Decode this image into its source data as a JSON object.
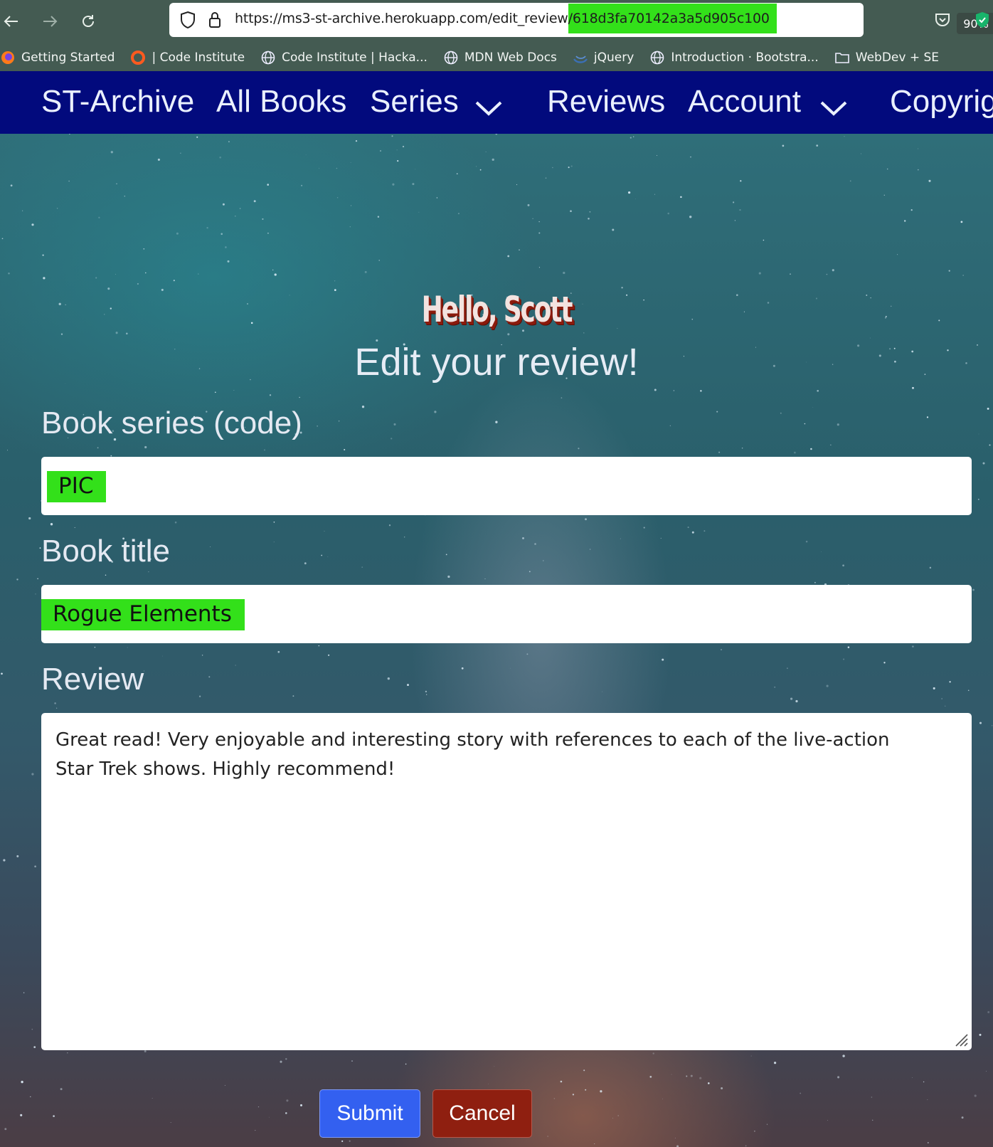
{
  "browser": {
    "url_prefix": "https://ms3-st-archive.herokuapp.com/edit_review",
    "url_highlight": "/618d3fa70142a3a5d905c100",
    "zoom": "90%",
    "bookmarks": [
      {
        "label": "Getting Started",
        "icon": "firefox-icon"
      },
      {
        "label": "| Code Institute",
        "icon": "code-institute-icon"
      },
      {
        "label": "Code Institute | Hacka...",
        "icon": "globe-icon"
      },
      {
        "label": "MDN Web Docs",
        "icon": "globe-icon"
      },
      {
        "label": "jQuery",
        "icon": "jquery-icon"
      },
      {
        "label": "Introduction · Bootstra...",
        "icon": "globe-icon"
      },
      {
        "label": "WebDev + SE",
        "icon": "folder-icon"
      }
    ]
  },
  "navbar": {
    "brand": "ST-Archive",
    "all_books": "All Books",
    "series": "Series",
    "reviews": "Reviews",
    "account": "Account",
    "copyright": "Copyrig"
  },
  "main": {
    "greeting": "Hello, Scott",
    "subtitle": "Edit your review!",
    "series_label": "Book series (code)",
    "series_value": "PIC",
    "title_label": "Book title",
    "title_value": "Rogue Elements",
    "review_label": "Review",
    "review_text": "Great read! Very enjoyable and interesting story with references to each of the live-action Star Trek shows. Highly recommend!",
    "submit_label": "Submit",
    "cancel_label": "Cancel"
  },
  "colors": {
    "navbar_bg": "#020a7d",
    "highlight": "#33e01a",
    "submit": "#3360f0",
    "cancel": "#8f1f10"
  }
}
